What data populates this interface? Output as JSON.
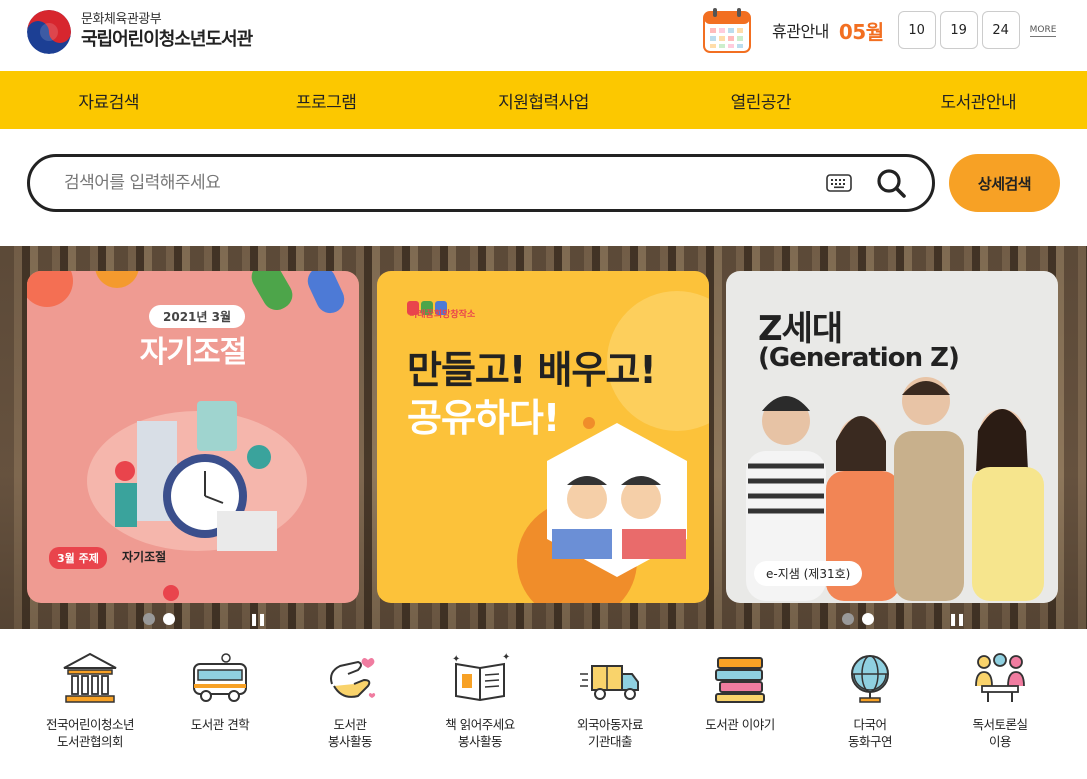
{
  "header": {
    "logo_sub": "문화체육관광부",
    "logo_main": "국립어린이청소년도서관",
    "holiday_label": "휴관안내",
    "holiday_month": "05월",
    "holiday_days": [
      "10",
      "19",
      "24"
    ],
    "more_label": "MORE"
  },
  "nav": {
    "items": [
      "자료검색",
      "프로그램",
      "지원협력사업",
      "열린공간",
      "도서관안내"
    ]
  },
  "search": {
    "placeholder": "검색어를 입력해주세요",
    "advanced_label": "상세검색"
  },
  "banner": {
    "card1": {
      "badge": "2021년 3월",
      "title": "자기조절",
      "theme_badge": "3월 주제",
      "theme_text": "자기조절"
    },
    "card2": {
      "brand": "미래꿈희망창작소",
      "title_line1": "만들고! 배우고!",
      "title_line2": "공유하다!"
    },
    "card3": {
      "title_line1": "Z세대",
      "title_line2": "(Generation Z)",
      "tag": "e-지샘 (제31호)"
    }
  },
  "quick_links": [
    {
      "label": "전국어린이청소년\n도서관협의회",
      "icon": "library-building-icon"
    },
    {
      "label": "도서관 견학",
      "icon": "bus-icon"
    },
    {
      "label": "도서관\n봉사활동",
      "icon": "helping-hands-icon"
    },
    {
      "label": "책 읽어주세요\n봉사활동",
      "icon": "open-book-icon"
    },
    {
      "label": "외국아동자료\n기관대출",
      "icon": "delivery-truck-icon"
    },
    {
      "label": "도서관 이야기",
      "icon": "book-stack-icon"
    },
    {
      "label": "다국어\n동화구연",
      "icon": "globe-icon"
    },
    {
      "label": "독서토론실\n이용",
      "icon": "discussion-icon"
    }
  ],
  "colors": {
    "nav_bg": "#fcc800",
    "accent_orange": "#f26f21",
    "adv_button": "#f7a125"
  }
}
